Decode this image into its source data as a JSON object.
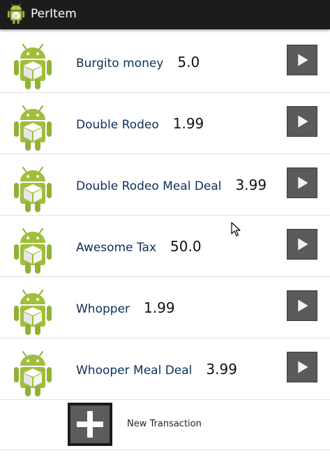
{
  "app": {
    "title": "PerItem",
    "icon": "android-icon"
  },
  "items": [
    {
      "name": "Burgito money",
      "price": "5.0"
    },
    {
      "name": "Double Rodeo",
      "price": "1.99"
    },
    {
      "name": "Double Rodeo Meal Deal",
      "price": "3.99"
    },
    {
      "name": "Awesome Tax",
      "price": "50.0"
    },
    {
      "name": "Whopper",
      "price": "1.99"
    },
    {
      "name": "Whooper Meal Deal",
      "price": "3.99"
    }
  ],
  "new_transaction": {
    "label": "New Transaction",
    "icon": "plus-icon"
  },
  "colors": {
    "action_bar": "#1c1c1c",
    "item_name": "#0b2f5a",
    "android_green": "#9fbf3b",
    "button_gray": "#5a5a5a"
  }
}
